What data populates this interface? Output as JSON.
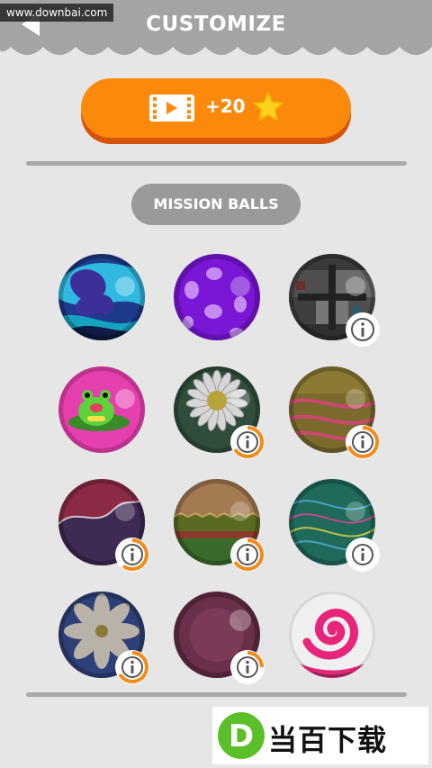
{
  "header": {
    "title": "CUSTOMIZE",
    "watermark": "www.downbai.com",
    "background": "#a4a4a4"
  },
  "reward": {
    "label": "+20",
    "icons": [
      "film-icon",
      "star-icon"
    ],
    "color": "#fb8a0c"
  },
  "section": {
    "label": "MISSION BALLS"
  },
  "balls": [
    {
      "name": "ball-blue-swirl",
      "locked": false,
      "info": false
    },
    {
      "name": "ball-purple-spotted",
      "locked": false,
      "info": false
    },
    {
      "name": "ball-tv-test",
      "locked": true,
      "info": true,
      "progress": 0
    },
    {
      "name": "ball-frog",
      "locked": false,
      "info": false
    },
    {
      "name": "ball-daisy-green",
      "locked": true,
      "info": true,
      "progress": 0.6
    },
    {
      "name": "ball-olive-stripes",
      "locked": true,
      "info": true,
      "progress": 0.7
    },
    {
      "name": "ball-maroon-wave",
      "locked": true,
      "info": true,
      "progress": 0.55
    },
    {
      "name": "ball-cake-layers",
      "locked": true,
      "info": true,
      "progress": 0.6
    },
    {
      "name": "ball-teal-lines",
      "locked": true,
      "info": true,
      "progress": 0
    },
    {
      "name": "ball-navy-flower",
      "locked": true,
      "info": true,
      "progress": 0.6
    },
    {
      "name": "ball-plum",
      "locked": true,
      "info": true,
      "progress": 0.25
    },
    {
      "name": "ball-candy-swirl",
      "locked": false,
      "info": false
    }
  ],
  "bottom_watermark": {
    "letter": "D",
    "text": "当百下载"
  }
}
